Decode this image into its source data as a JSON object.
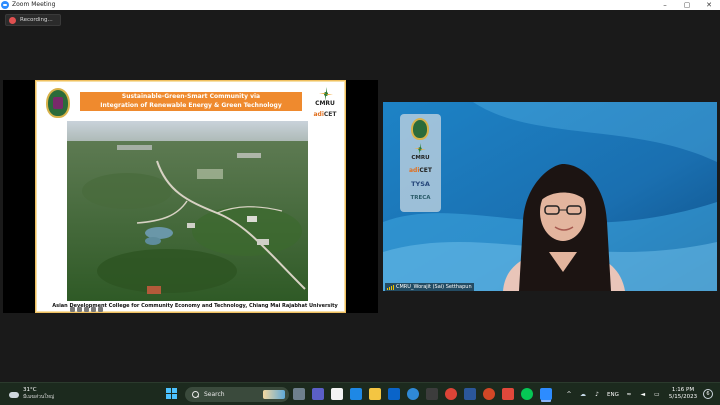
{
  "window": {
    "title": "Zoom Meeting",
    "controls": {
      "minimize": "–",
      "maximize": "▢",
      "close": "✕"
    }
  },
  "recording": {
    "label": "Recording..."
  },
  "slide": {
    "title_line1": "Sustainable-Green-Smart Community via",
    "title_line2": "Integration of Renewable Energy & Green Technology",
    "cmru": "CMRU",
    "adicet_prefix": "adi",
    "adicet_suffix": "CET",
    "caption": "Asian Development College for Community Economy and Technology, Chiang Mai Rajabhat University"
  },
  "video": {
    "panel": {
      "cmru": "CMRU",
      "adicet_prefix": "adi",
      "adicet_suffix": "CET",
      "tysa": "TYSA",
      "treca": "TRECA"
    },
    "participant_name": "CMRU_Worajit (Sai) Setthapun"
  },
  "taskbar": {
    "weather_temp": "31°C",
    "weather_desc": "มีเมฆส่วนใหญ่",
    "search_label": "Search",
    "language": "ENG",
    "clock_time": "1:16 PM",
    "clock_date": "5/15/2023",
    "notification_count": "6"
  },
  "colors": {
    "zoom_blue": "#2d8cff",
    "recording_red": "#e05050",
    "banner_orange": "#ef8a2e",
    "taskbar": "#1c2a1e"
  }
}
